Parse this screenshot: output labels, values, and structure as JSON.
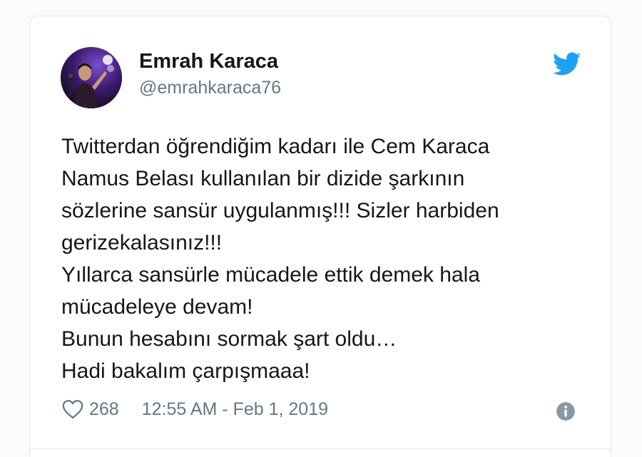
{
  "tweet": {
    "author_name": "Emrah Karaca",
    "author_handle": "@emrahkaraca76",
    "text_lines": [
      "Twitterdan öğrendiğim kadarı ile Cem Karaca",
      "Namus Belası kullanılan bir dizide şarkının",
      "sözlerine sansür uygulanmış!!! Sizler harbiden",
      "gerizekalasınız!!!",
      "Yıllarca sansürle mücadele ettik demek hala",
      "mücadeleye devam!",
      "Bunun hesabını sormak şart oldu…",
      "Hadi bakalım çarpışmaaa!"
    ],
    "like_count": "268",
    "timestamp": "12:55 AM - Feb 1, 2019"
  },
  "icons": {
    "brand": "twitter-bird-icon",
    "like": "heart-icon",
    "info": "info-icon"
  },
  "colors": {
    "brand_blue": "#1da1f2",
    "text_primary": "#14171a",
    "text_secondary": "#657786",
    "info_gray": "#8899a6",
    "border": "#e1e8ed"
  }
}
